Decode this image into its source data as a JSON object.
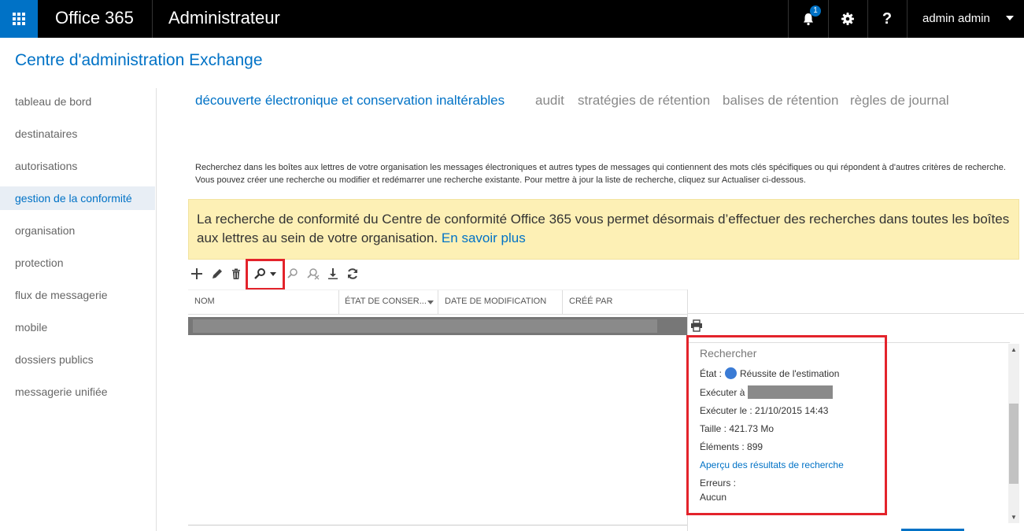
{
  "topbar": {
    "brand": "Office 365",
    "app_title": "Administrateur",
    "notification_count": "1",
    "help_label": "?",
    "user_name": "admin admin"
  },
  "page_title": "Centre d'administration Exchange",
  "nav": {
    "items": [
      {
        "label": "tableau de bord"
      },
      {
        "label": "destinataires"
      },
      {
        "label": "autorisations"
      },
      {
        "label": "gestion de la conformité"
      },
      {
        "label": "organisation"
      },
      {
        "label": "protection"
      },
      {
        "label": "flux de messagerie"
      },
      {
        "label": "mobile"
      },
      {
        "label": "dossiers publics"
      },
      {
        "label": "messagerie unifiée"
      }
    ],
    "active": "gestion de la conformité"
  },
  "tabs": [
    {
      "label": "découverte électronique et conservation inaltérables"
    },
    {
      "label": "audit"
    },
    {
      "label": "stratégies de rétention"
    },
    {
      "label": "balises de rétention"
    },
    {
      "label": "règles de journal"
    }
  ],
  "description": "Recherchez dans les boîtes aux lettres de votre organisation les messages électroniques et autres types de messages qui contiennent des mots clés spécifiques ou qui répondent à d'autres critères de recherche. Vous pouvez créer une recherche ou modifier et redémarrer une recherche existante. Pour mettre à jour la liste de recherche, cliquez sur Actualiser ci-dessous.",
  "notice": {
    "text": "La recherche de conformité du Centre de conformité Office 365 vous permet désormais d’effectuer des recherches dans toutes les boîtes aux lettres au sein de votre organisation.",
    "link": "En savoir plus"
  },
  "grid": {
    "columns": [
      "NOM",
      "ÉTAT DE CONSER...",
      "DATE DE MODIFICATION",
      "CRÉÉ PAR"
    ]
  },
  "details": {
    "title": "Rechercher",
    "state_label": "État :",
    "state_value": "Réussite de l'estimation",
    "run_by_label": "Exécuter à :",
    "run_on": "Exécuter le : 21/10/2015 14:43",
    "size": "Taille : 421.73 Mo",
    "items": "Éléments : 899",
    "preview_link": "Aperçu des résultats de recherche",
    "errors_label": "Erreurs :",
    "errors_value": "Aucun"
  }
}
